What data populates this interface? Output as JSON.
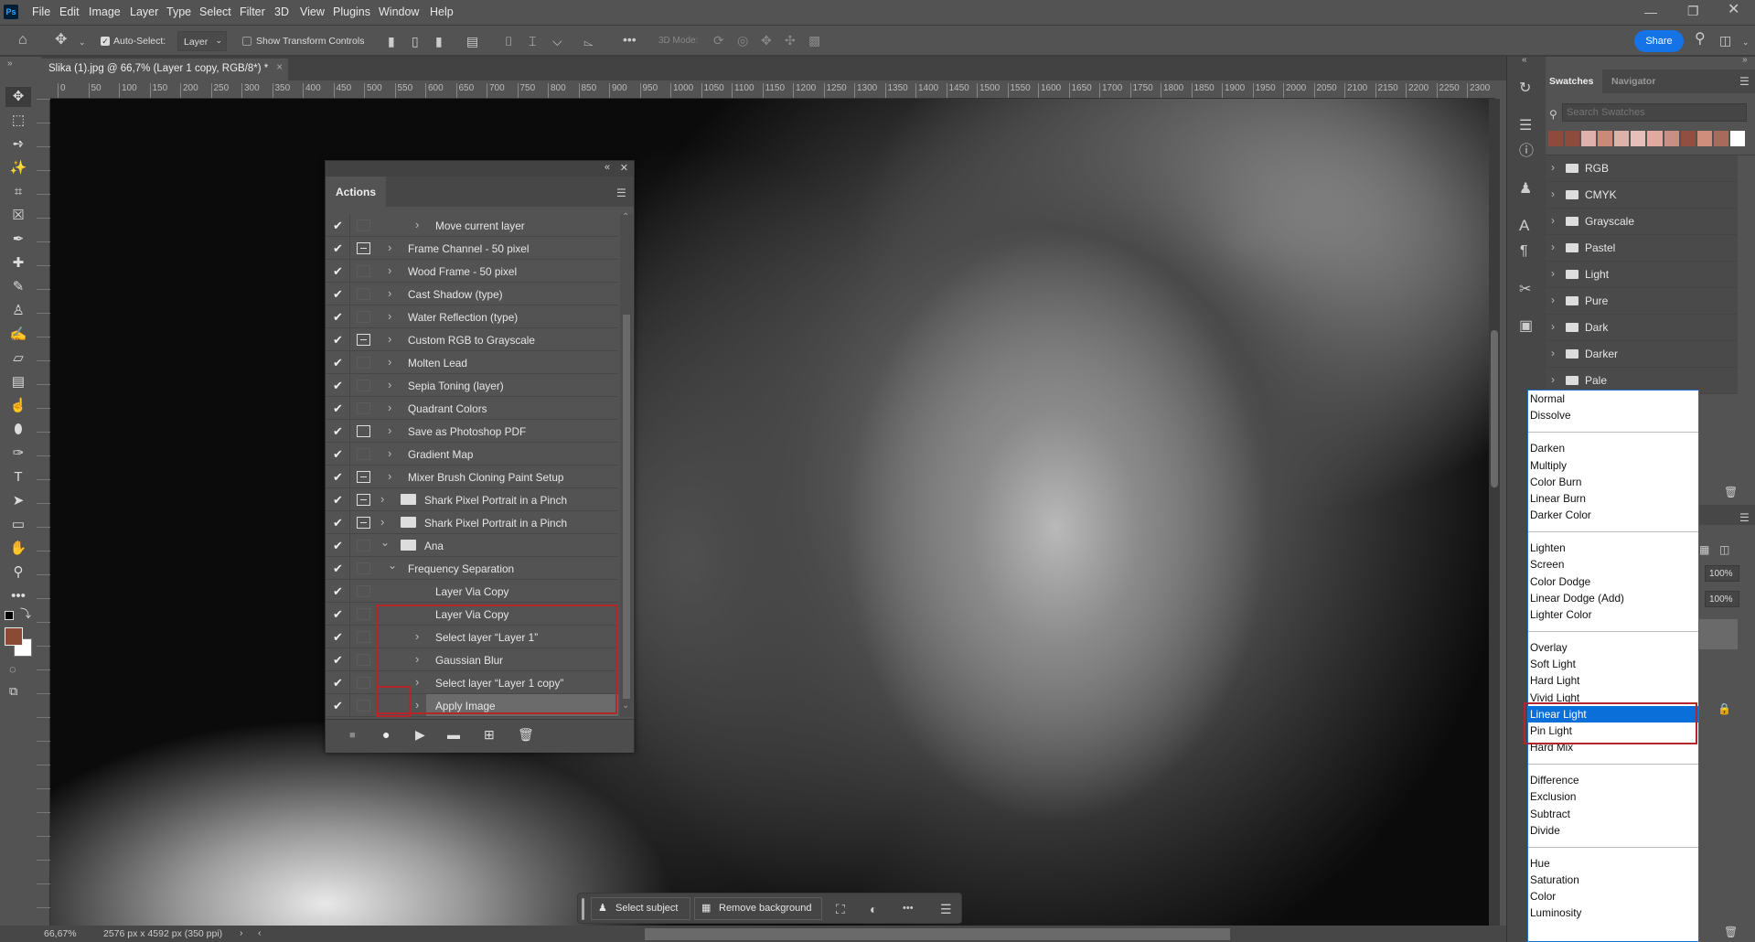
{
  "app": {
    "logo": "Ps"
  },
  "menu": [
    "File",
    "Edit",
    "Image",
    "Layer",
    "Type",
    "Select",
    "Filter",
    "3D",
    "View",
    "Plugins",
    "Window",
    "Help"
  ],
  "options": {
    "auto_select_label": "Auto-Select:",
    "auto_select_checked": true,
    "target_value": "Layer",
    "show_transform_label": "Show Transform Controls",
    "show_transform_checked": false,
    "mode_3d_label": "3D Mode:",
    "share_label": "Share"
  },
  "document_tab": {
    "title": "Slika (1).jpg @ 66,7% (Layer 1 copy, RGB/8*) *"
  },
  "ruler": {
    "start": 0,
    "end": 2300,
    "step": 50
  },
  "status": {
    "zoom": "66,67%",
    "info": "2576 px x 4592 px (350 ppi)"
  },
  "context_bar": {
    "select_subject": "Select subject",
    "remove_background": "Remove background"
  },
  "actions_panel": {
    "tab": "Actions",
    "rows": [
      {
        "label": "Move current layer",
        "level": 2,
        "expander": "right",
        "dialog": "none"
      },
      {
        "label": "Frame Channel - 50 pixel",
        "level": 1,
        "expander": "right",
        "dialog": "on"
      },
      {
        "label": "Wood Frame - 50 pixel",
        "level": 1,
        "expander": "right",
        "dialog": "none"
      },
      {
        "label": "Cast Shadow (type)",
        "level": 1,
        "expander": "right",
        "dialog": "none"
      },
      {
        "label": "Water Reflection (type)",
        "level": 1,
        "expander": "right",
        "dialog": "none"
      },
      {
        "label": "Custom RGB to Grayscale",
        "level": 1,
        "expander": "right",
        "dialog": "on"
      },
      {
        "label": "Molten Lead",
        "level": 1,
        "expander": "right",
        "dialog": "none"
      },
      {
        "label": "Sepia Toning (layer)",
        "level": 1,
        "expander": "right",
        "dialog": "none"
      },
      {
        "label": "Quadrant Colors",
        "level": 1,
        "expander": "right",
        "dialog": "none"
      },
      {
        "label": "Save as Photoshop PDF",
        "level": 1,
        "expander": "right",
        "dialog": "empty"
      },
      {
        "label": "Gradient Map",
        "level": 1,
        "expander": "right",
        "dialog": "none"
      },
      {
        "label": "Mixer Brush Cloning Paint Setup",
        "level": 1,
        "expander": "right",
        "dialog": "on"
      },
      {
        "label": "Shark Pixel Portrait in a Pinch",
        "level": 0,
        "expander": "right",
        "dialog": "on",
        "folder": true
      },
      {
        "label": "Shark Pixel Portrait in a Pinch",
        "level": 0,
        "expander": "right",
        "dialog": "on",
        "folder": true
      },
      {
        "label": "Ana",
        "level": 0,
        "expander": "down",
        "dialog": "none",
        "folder": true
      },
      {
        "label": "Frequency Separation",
        "level": 1,
        "expander": "down",
        "dialog": "none"
      },
      {
        "label": "Layer Via Copy",
        "level": 2,
        "expander": "none",
        "dialog": "none"
      },
      {
        "label": "Layer Via Copy",
        "level": 2,
        "expander": "none",
        "dialog": "none"
      },
      {
        "label": "Select layer “Layer 1”",
        "level": 2,
        "expander": "right",
        "dialog": "none"
      },
      {
        "label": "Gaussian Blur",
        "level": 2,
        "expander": "right",
        "dialog": "none"
      },
      {
        "label": "Select layer “Layer 1 copy”",
        "level": 2,
        "expander": "right",
        "dialog": "none"
      },
      {
        "label": "Apply Image",
        "level": 2,
        "expander": "right",
        "dialog": "none",
        "selected": true
      }
    ]
  },
  "swatches_panel": {
    "tabs": [
      "Swatches",
      "Navigator"
    ],
    "active_tab": "Swatches",
    "search_placeholder": "Search Swatches",
    "recent_colors": [
      "#8e4a3c",
      "#8c4b3d",
      "#dfb1ac",
      "#c98b77",
      "#ddb2aa",
      "#e5c0bb",
      "#e0aa9f",
      "#c98f84",
      "#8f5040",
      "#cf8d7c",
      "#a86a5a",
      "#ffffff"
    ],
    "groups": [
      "RGB",
      "CMYK",
      "Grayscale",
      "Pastel",
      "Light",
      "Pure",
      "Dark",
      "Darker",
      "Pale"
    ]
  },
  "layers_panel": {
    "opacity": "100%",
    "fill": "100%"
  },
  "blend_dropdown": {
    "selected": "Linear Light",
    "groups": [
      [
        "Normal",
        "Dissolve"
      ],
      [
        "Darken",
        "Multiply",
        "Color Burn",
        "Linear Burn",
        "Darker Color"
      ],
      [
        "Lighten",
        "Screen",
        "Color Dodge",
        "Linear Dodge (Add)",
        "Lighter Color"
      ],
      [
        "Overlay",
        "Soft Light",
        "Hard Light",
        "Vivid Light",
        "Linear Light",
        "Pin Light",
        "Hard Mix"
      ],
      [
        "Difference",
        "Exclusion",
        "Subtract",
        "Divide"
      ],
      [
        "Hue",
        "Saturation",
        "Color",
        "Luminosity"
      ]
    ]
  },
  "colors": {
    "foreground": "#8a4a34",
    "background": "#ffffff",
    "accent": "#1473e6",
    "highlight_box": "#b3262a",
    "selection": "#0a6fd8"
  }
}
